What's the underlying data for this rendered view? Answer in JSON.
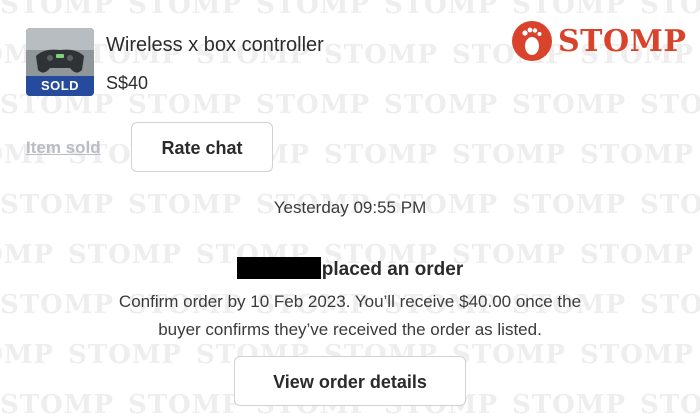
{
  "listing": {
    "title": "Wireless x box controller",
    "price": "S$40",
    "status_badge": "SOLD"
  },
  "watermark": {
    "brand_text": "STOMP",
    "logo_color": "#d9422b"
  },
  "actions": {
    "item_sold_label": "Item sold",
    "rate_chat_label": "Rate chat",
    "view_order_label": "View order details"
  },
  "chat": {
    "timestamp": "Yesterday 09:55 PM",
    "order_event": "placed an order",
    "order_note_line1": "Confirm order by 10 Feb 2023. You’ll receive $40.00 once the",
    "order_note_line2": "buyer confirms they’ve received the order as listed."
  },
  "icons": {
    "logo": "footprint-icon",
    "thumbnail": "controller-photo"
  }
}
